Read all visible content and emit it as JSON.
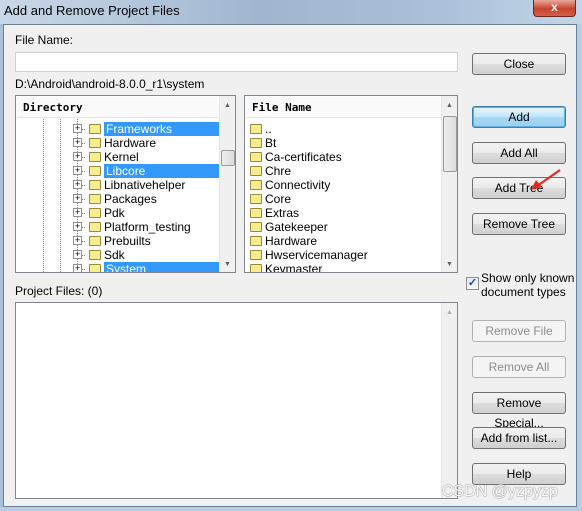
{
  "window": {
    "title": "Add and Remove Project Files",
    "close_glyph": "x"
  },
  "file_name": {
    "label": "File Name:",
    "value": "",
    "placeholder": ""
  },
  "current_path": "D:\\Android\\android-8.0.0_r1\\system",
  "directory": {
    "header": "Directory",
    "items": [
      {
        "label": "Frameworks",
        "selected": true
      },
      {
        "label": "Hardware",
        "selected": false
      },
      {
        "label": "Kernel",
        "selected": false
      },
      {
        "label": "Libcore",
        "selected": true
      },
      {
        "label": "Libnativehelper",
        "selected": false
      },
      {
        "label": "Packages",
        "selected": false
      },
      {
        "label": "Pdk",
        "selected": false
      },
      {
        "label": "Platform_testing",
        "selected": false
      },
      {
        "label": "Prebuilts",
        "selected": false
      },
      {
        "label": "Sdk",
        "selected": false
      },
      {
        "label": "System",
        "selected": true
      }
    ]
  },
  "files": {
    "header": "File Name",
    "items": [
      "..",
      "Bt",
      "Ca-certificates",
      "Chre",
      "Connectivity",
      "Core",
      "Extras",
      "Gatekeeper",
      "Hardware",
      "Hwservicemanager",
      "Keymaster"
    ]
  },
  "buttons": {
    "close": "Close",
    "add": "Add",
    "add_all": "Add All",
    "add_tree": "Add Tree",
    "remove_tree": "Remove Tree",
    "remove_file": "Remove File",
    "remove_all": "Remove All",
    "remove_special": "Remove Special...",
    "add_from_list": "Add from list...",
    "help": "Help"
  },
  "show_known": {
    "line1": "Show only known",
    "line2": "document types",
    "checked": true
  },
  "project_files": {
    "label": "Project Files: (0)",
    "items": []
  },
  "watermark": "CSDN @yzpyzp",
  "colors": {
    "selection": "#3399ff",
    "annotation_arrow": "#e8251e"
  }
}
